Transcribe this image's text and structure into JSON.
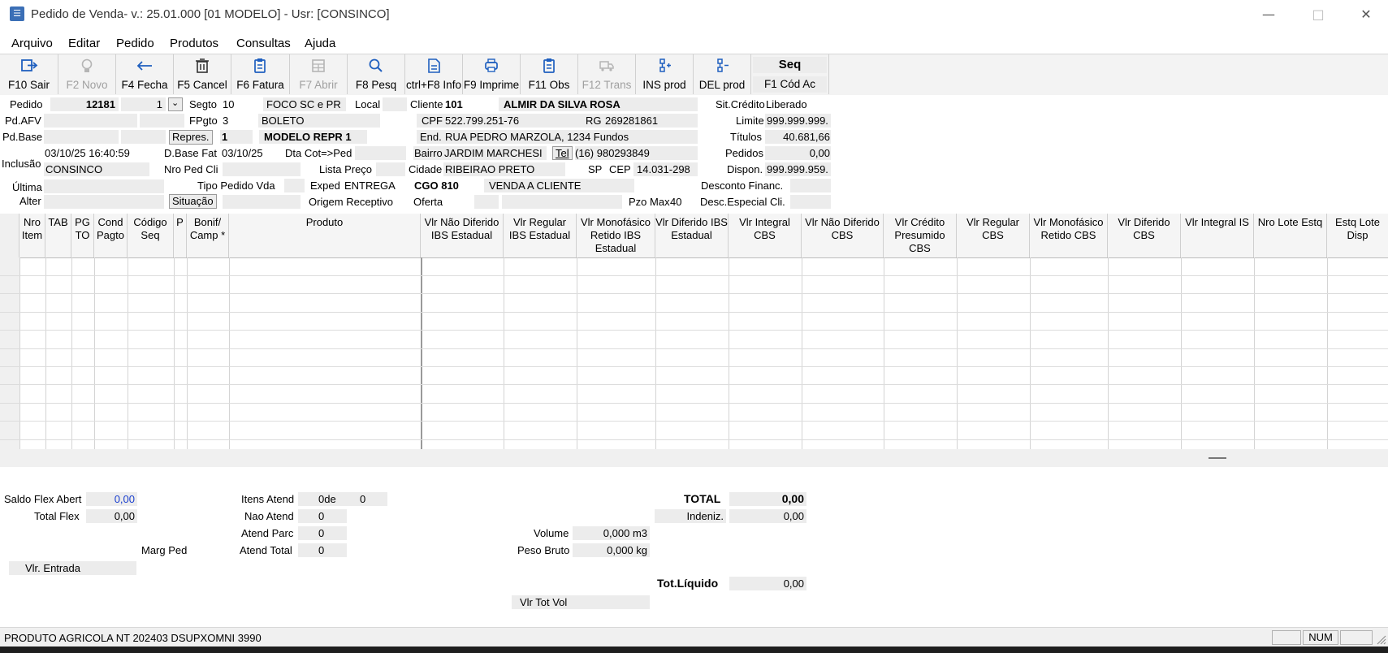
{
  "window": {
    "title": "Pedido de Venda- v.: 25.01.000  [01 MODELO] - Usr: [CONSINCO]",
    "app_icon_glyph": "☰",
    "minimize": "—",
    "maximize": "□",
    "close": "✕"
  },
  "menu": [
    "Arquivo",
    "Editar",
    "Pedido",
    "Produtos",
    "Consultas",
    "Ajuda"
  ],
  "toolbar": [
    {
      "label": "F10 Sair",
      "icon": "exit-icon",
      "enabled": true
    },
    {
      "label": "F2 Novo",
      "icon": "lightbulb-icon",
      "enabled": false
    },
    {
      "label": "F4 Fecha",
      "icon": "arrow-left-icon",
      "enabled": true
    },
    {
      "label": "F5 Cancel",
      "icon": "trash-icon",
      "enabled": true
    },
    {
      "label": "F6 Fatura",
      "icon": "clipboard-icon",
      "enabled": true
    },
    {
      "label": "F7 Abrir",
      "icon": "table-icon",
      "enabled": false
    },
    {
      "label": "F8 Pesq",
      "icon": "search-icon",
      "enabled": true
    },
    {
      "label": "ctrl+F8 Info",
      "icon": "document-icon",
      "enabled": true
    },
    {
      "label": "F9 Imprime",
      "icon": "printer-icon",
      "enabled": true
    },
    {
      "label": "F11 Obs",
      "icon": "clipboard-icon",
      "enabled": true
    },
    {
      "label": "F12 Trans",
      "icon": "truck-icon",
      "enabled": false
    },
    {
      "label": "INS prod",
      "icon": "insert-product-icon",
      "enabled": true
    },
    {
      "label": "DEL prod",
      "icon": "delete-product-icon",
      "enabled": true
    }
  ],
  "seq_button": {
    "top": "Seq",
    "label": "F1 Cód Ac"
  },
  "header": {
    "pedido_label": "Pedido",
    "pedido_value": "12181",
    "pedido_seq": "1",
    "segto_label": "Segto",
    "segto_value": "10",
    "segto_name": "FOCO SC e PR",
    "local_label": "Local",
    "pdafv_label": "Pd.AFV",
    "fpgto_label": "FPgto",
    "fpgto_value": "3",
    "fpgto_name": "BOLETO",
    "pdbase_label": "Pd.Base",
    "repres_button": "Repres.",
    "repres_value": "1",
    "repres_name": "MODELO REPR 1",
    "inclusao_label": "Inclusão",
    "inclusao_date": "03/10/25 16:40:59",
    "inclusao_user": "CONSINCO",
    "dbase_label": "D.Base Fat",
    "dbase_value": "03/10/25",
    "dtacot_label": "Dta Cot=>Ped",
    "nroped_label": "Nro Ped Cli",
    "listapreco_label": "Lista Preço",
    "ultima_label": "Última",
    "alter_label": "Alter",
    "tipo_label": "Tipo Pedido Vda",
    "exped_label": "Exped",
    "exped_value": "ENTREGA",
    "cgo_value": "CGO 810",
    "cgo_name": "VENDA A CLIENTE",
    "situacao_button": "Situação",
    "origem_label": "Origem Receptivo",
    "oferta_label": "Oferta",
    "pzomax_label": "Pzo Max",
    "pzomax_value": "40"
  },
  "cliente": {
    "cliente_label": "Cliente",
    "cliente_code": "101",
    "cliente_name": "ALMIR DA SILVA ROSA",
    "cpf_label": "CPF",
    "cpf_value": "522.799.251-76",
    "rg_label": "RG",
    "rg_value": "269281861",
    "end_label": "End.",
    "end_value": "RUA PEDRO MARZOLA, 1234 Fundos",
    "bairro_label": "Bairro",
    "bairro_value": "JARDIM MARCHESI",
    "tel_button": "Tel",
    "tel_value": "(16) 980293849",
    "cidade_label": "Cidade",
    "cidade_value": "RIBEIRAO PRETO",
    "uf_value": "SP",
    "cep_label": "CEP",
    "cep_value": "14.031-298"
  },
  "credito": {
    "sit_label": "Sit.Crédito",
    "sit_value": "Liberado",
    "limite_label": "Limite",
    "limite_value": "999.999.999.",
    "titulos_label": "Títulos",
    "titulos_value": "40.681,66",
    "pedidos_label": "Pedidos",
    "pedidos_value": "0,00",
    "dispon_label": "Dispon.",
    "dispon_value": "999.999.959.",
    "desconto_label": "Desconto Financ.",
    "desc_especial_label": "Desc.Especial Cli."
  },
  "grid": {
    "columns": [
      "Nro Item",
      "TAB",
      "PG TO",
      "Cond Pagto",
      "Código Seq",
      "P",
      "Bonif/ Camp *",
      "Produto",
      "Vlr Não Diferido IBS Estadual",
      "Vlr Regular IBS Estadual",
      "Vlr Monofásico Retido IBS Estadual",
      "Vlr Diferido IBS Estadual",
      "Vlr Integral CBS",
      "Vlr Não Diferido CBS",
      "Vlr Crédito Presumido CBS",
      "Vlr Regular CBS",
      "Vlr Monofásico Retido CBS",
      "Vlr Diferido CBS",
      "Vlr Integral IS",
      "Nro Lote Estq",
      "Estq Lote Disp"
    ]
  },
  "summary": {
    "saldo_flex_label": "Saldo Flex Abert",
    "saldo_flex_value": "0,00",
    "total_flex_label": "Total Flex",
    "total_flex_value": "0,00",
    "marg_ped_label": "Marg Ped",
    "vlr_entrada_label": "Vlr. Entrada",
    "itens_atend_label": "Itens Atend",
    "itens_atend_value": "0",
    "itens_de_label": "de",
    "itens_de_value": "0",
    "nao_atend_label": "Nao Atend",
    "nao_atend_value": "0",
    "atend_parc_label": "Atend Parc",
    "atend_parc_value": "0",
    "atend_total_label": "Atend Total",
    "atend_total_value": "0",
    "volume_label": "Volume",
    "volume_value": "0,000 m3",
    "peso_label": "Peso Bruto",
    "peso_value": "0,000 kg",
    "vlr_tot_vol_label": "Vlr Tot Vol",
    "total_label": "TOTAL",
    "total_value": "0,00",
    "indeniz_label": "Indeniz.",
    "indeniz_value": "0,00",
    "tot_liquido_label": "Tot.Líquido",
    "tot_liquido_value": "0,00"
  },
  "status": {
    "message": "PRODUTO AGRICOLA NT 202403 DSUPXOMNI 3990",
    "num": "NUM"
  },
  "colors": {
    "accent": "#1f5fbf",
    "link_value": "#1a3fcf",
    "disabled": "#a0a0a0"
  }
}
